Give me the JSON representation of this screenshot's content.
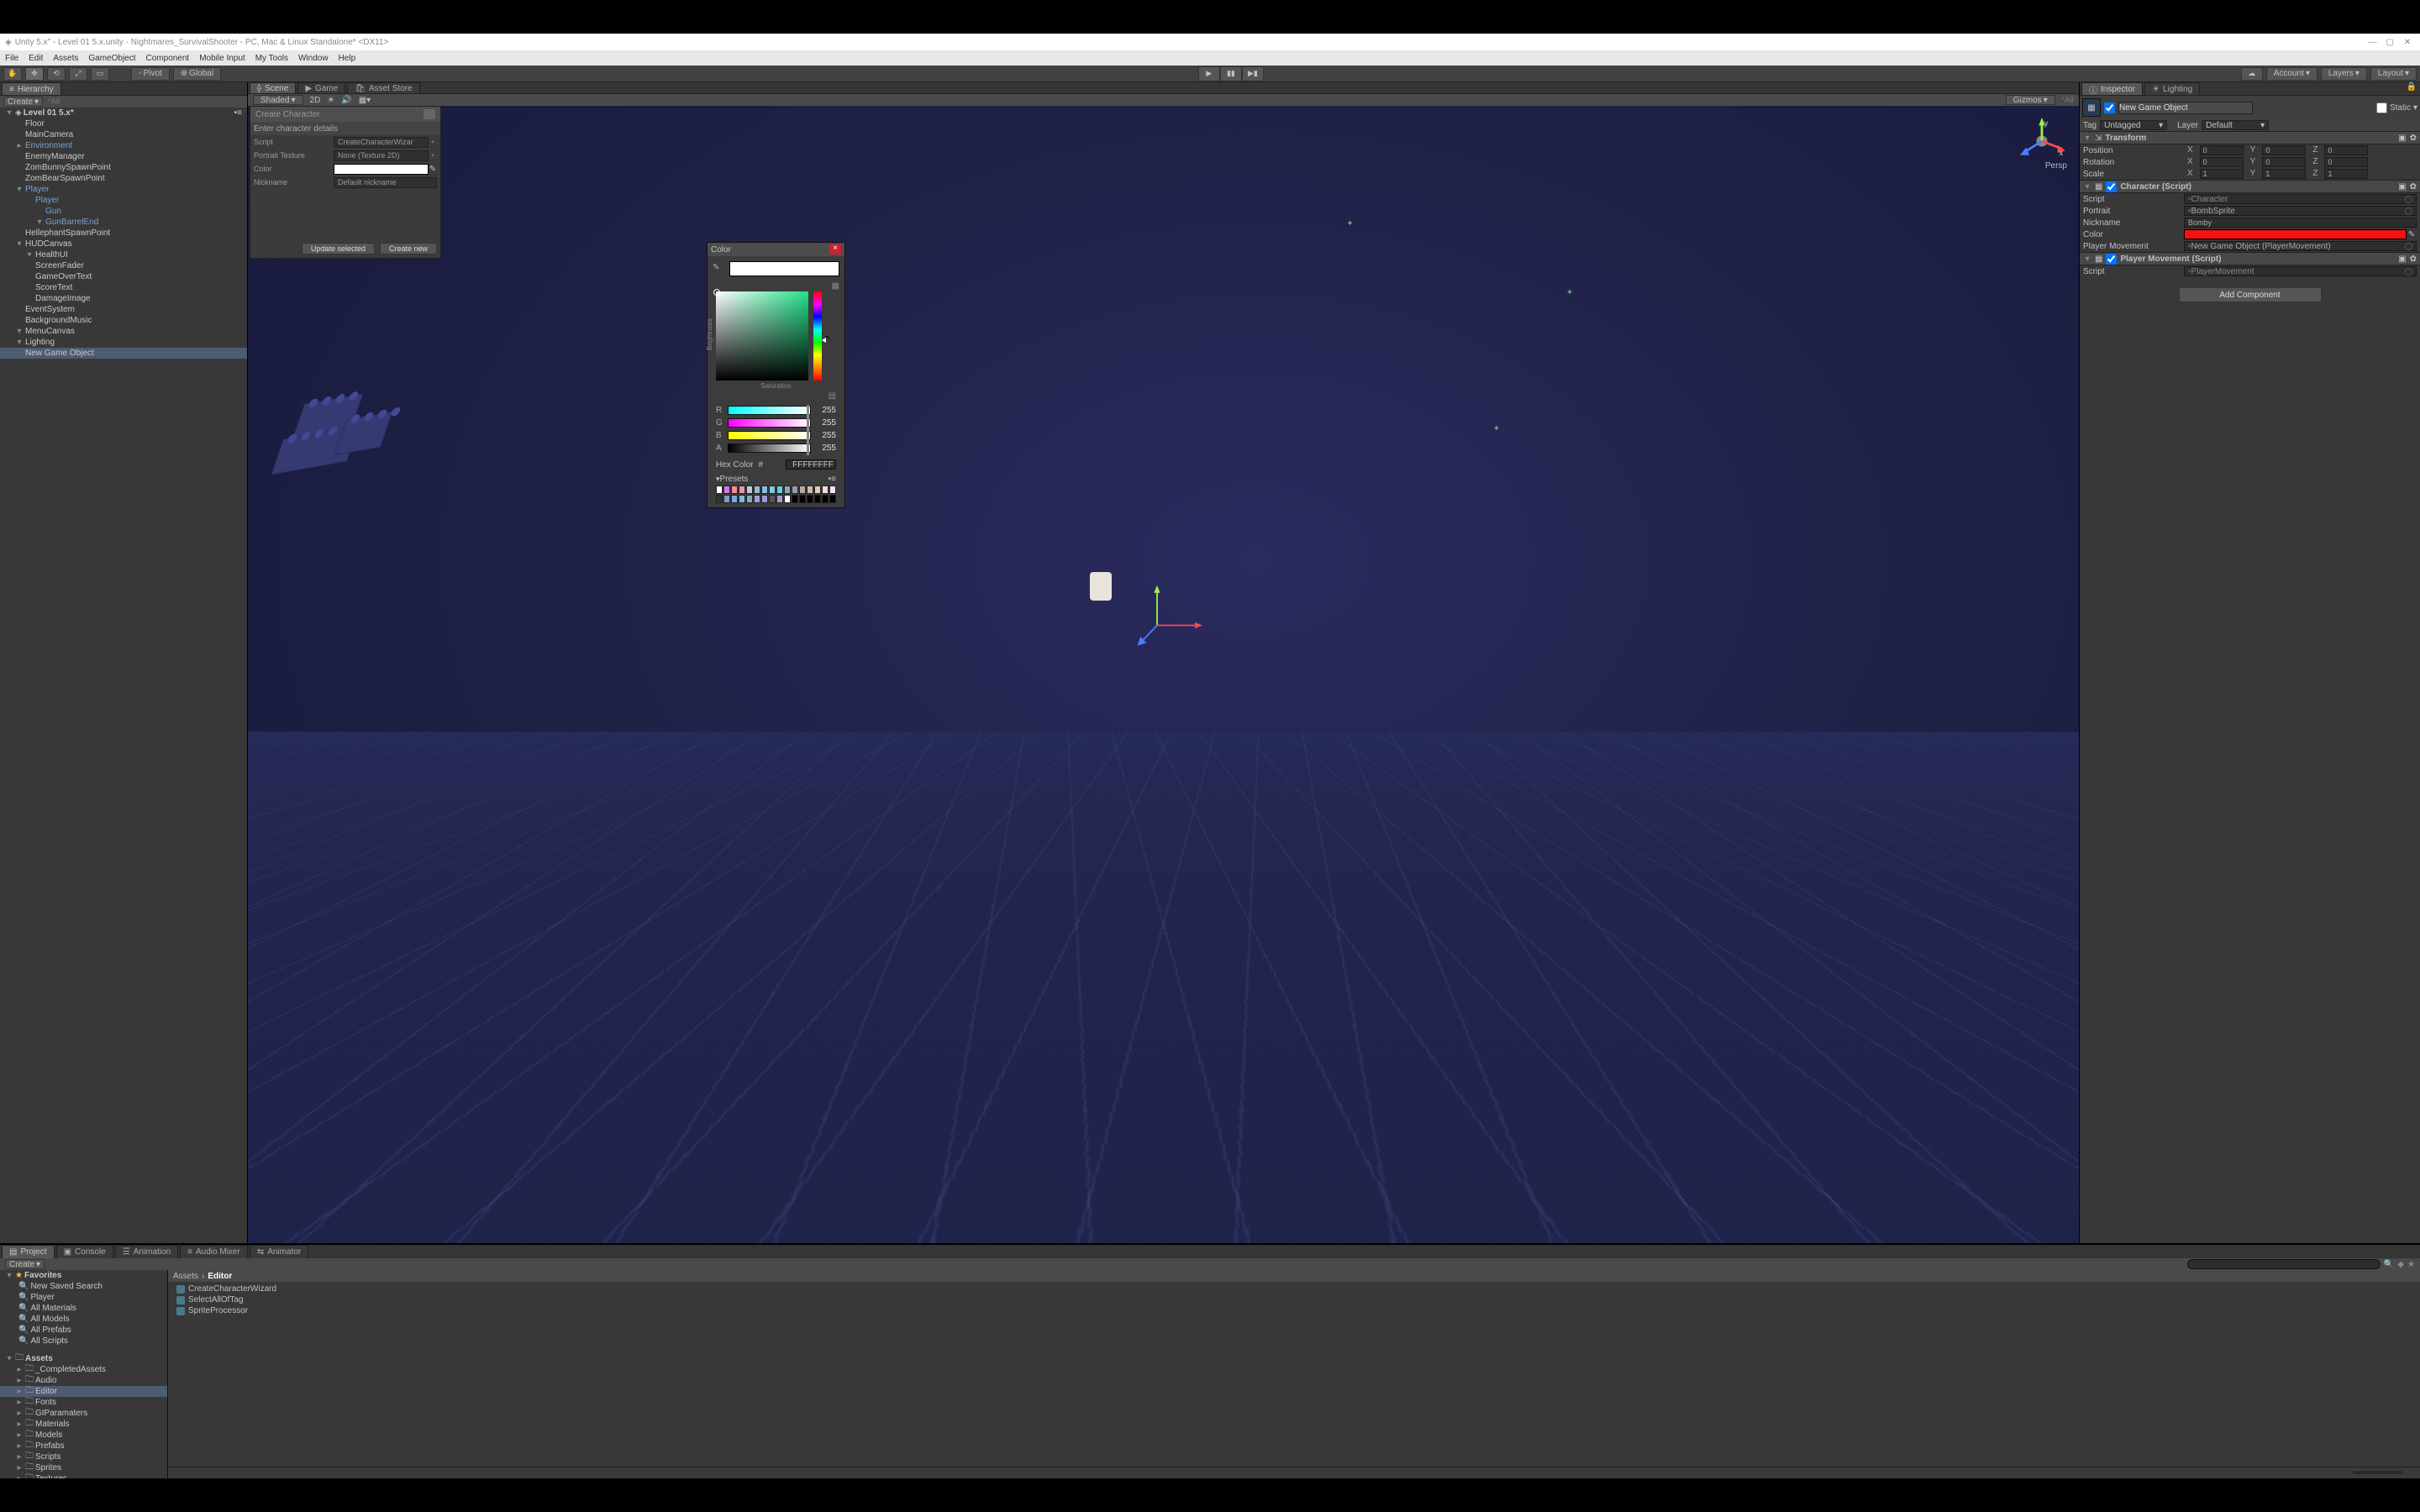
{
  "window": {
    "title": "Unity 5.x\" - Level 01 5.x.unity - Nightmares_SurvivalShooter - PC, Mac & Linux Standalone* <DX11>",
    "min": "—",
    "max": "▢",
    "close": "✕"
  },
  "menu": [
    "File",
    "Edit",
    "Assets",
    "GameObject",
    "Component",
    "Mobile Input",
    "My Tools",
    "Window",
    "Help"
  ],
  "toolbar": {
    "pivot": "Pivot",
    "global": "Global",
    "cloud_icon": "☁",
    "account": "Account",
    "layers": "Layers",
    "layout": "Layout"
  },
  "hierarchy": {
    "tab": "Hierarchy",
    "create": "Create",
    "all": "All",
    "scene": "Level 01 5.x*",
    "items": [
      {
        "t": "Floor",
        "d": 1
      },
      {
        "t": "MainCamera",
        "d": 1
      },
      {
        "t": "Environment",
        "d": 1,
        "blue": true
      },
      {
        "t": "EnemyManager",
        "d": 1
      },
      {
        "t": "ZomBunnySpawnPoint",
        "d": 1
      },
      {
        "t": "ZomBearSpawnPoint",
        "d": 1
      },
      {
        "t": "Player",
        "d": 1,
        "blue": true,
        "open": true
      },
      {
        "t": "Player",
        "d": 2,
        "blue": true
      },
      {
        "t": "Gun",
        "d": 3,
        "blue": true
      },
      {
        "t": "GunBarrelEnd",
        "d": 3,
        "blue": true,
        "open": true
      },
      {
        "t": "HellephantSpawnPoint",
        "d": 1
      },
      {
        "t": "HUDCanvas",
        "d": 1,
        "open": true
      },
      {
        "t": "HealthUI",
        "d": 2,
        "open": true
      },
      {
        "t": "ScreenFader",
        "d": 2
      },
      {
        "t": "GameOverText",
        "d": 2
      },
      {
        "t": "ScoreText",
        "d": 2
      },
      {
        "t": "DamageImage",
        "d": 2
      },
      {
        "t": "EventSystem",
        "d": 1
      },
      {
        "t": "BackgroundMusic",
        "d": 1
      },
      {
        "t": "MenuCanvas",
        "d": 1,
        "open": true
      },
      {
        "t": "Lighting",
        "d": 1,
        "open": true
      },
      {
        "t": "New Game Object",
        "d": 1,
        "sel": true
      }
    ]
  },
  "scene": {
    "tabs": [
      "Scene",
      "Game",
      "Asset Store"
    ],
    "shading": "Shaded",
    "twoD": "2D",
    "gizmos": "Gizmos",
    "all": "All",
    "persp": "Persp",
    "axis_y": "y",
    "axis_x": "x"
  },
  "wizard": {
    "title": "Create Character",
    "desc": "Enter character details",
    "rows": {
      "script_lbl": "Script",
      "script_val": "CreateCharacterWizar",
      "portrait_lbl": "Portrait Texture",
      "portrait_val": "None (Texture 2D)",
      "color_lbl": "Color",
      "nick_lbl": "Nickname",
      "nick_val": "Default nickname"
    },
    "update": "Update selected",
    "createnew": "Create new"
  },
  "inspector": {
    "tabs": [
      "Inspector",
      "Lighting"
    ],
    "name": "New Game Object",
    "static": "Static",
    "tag_lbl": "Tag",
    "tag_val": "Untagged",
    "layer_lbl": "Layer",
    "layer_val": "Default",
    "transform": {
      "title": "Transform",
      "position": "Position",
      "rotation": "Rotation",
      "scale": "Scale",
      "px": "0",
      "py": "0",
      "pz": "0",
      "rx": "0",
      "ry": "0",
      "rz": "0",
      "sx": "1",
      "sy": "1",
      "sz": "1"
    },
    "character": {
      "title": "Character (Script)",
      "script": "Script",
      "script_val": "Character",
      "portrait": "Portrait",
      "portrait_val": "BombSprite",
      "nickname": "Nickname",
      "nickname_val": "Bomby",
      "color": "Color",
      "pm": "Player Movement",
      "pm_val": "New Game Object (PlayerMovement)"
    },
    "pm_comp": {
      "title": "Player Movement (Script)",
      "script_val": "PlayerMovement"
    },
    "add": "Add Component"
  },
  "project": {
    "tabs": [
      "Project",
      "Console",
      "Animation",
      "Audio Mixer",
      "Animator"
    ],
    "create": "Create",
    "favorites_header": "Favorites",
    "favorites": [
      "New Saved Search",
      "Player",
      "All Materials",
      "All Models",
      "All Prefabs",
      "All Scripts"
    ],
    "assets_header": "Assets",
    "assets": [
      "_CompletedAssets",
      "Audio",
      "Editor",
      "Fonts",
      "GIParamaters",
      "Materials",
      "Models",
      "Prefabs",
      "Scripts",
      "Sprites",
      "Textures"
    ],
    "selected_asset": "Editor",
    "breadcrumb": "Assets  ›  Editor",
    "breadcrumb_a": "Assets",
    "breadcrumb_sep": "›",
    "breadcrumb_b": "Editor",
    "files": [
      "CreateCharacterWizard",
      "SelectAllOfTag",
      "SpriteProcessor"
    ]
  },
  "color_picker": {
    "title": "Color",
    "r": "255",
    "g": "255",
    "b": "255",
    "a": "255",
    "R": "R",
    "G": "G",
    "B": "B",
    "A": "A",
    "hex_lbl": "Hex Color",
    "hex_hash": "#",
    "hex": "FFFFFFFF",
    "saturation": "Saturation",
    "brightness": "Brightness",
    "presets_lbl": "Presets",
    "preset_colors": [
      [
        "#fff",
        "#c7e",
        "#f89",
        "#d9a",
        "#bcd",
        "#9bc",
        "#8bd",
        "#7cd",
        "#6cd",
        "#8ab",
        "#99a",
        "#ba9",
        "#cba",
        "#dcb",
        "#edd",
        "#fdf"
      ],
      [
        "#333",
        "#89c",
        "#7ad",
        "#7bd",
        "#8ab",
        "#a9d",
        "#99d",
        "#555",
        "#a9c",
        "#fff",
        "#000",
        "#000",
        "#000",
        "#000",
        "#000",
        "#000"
      ]
    ]
  }
}
